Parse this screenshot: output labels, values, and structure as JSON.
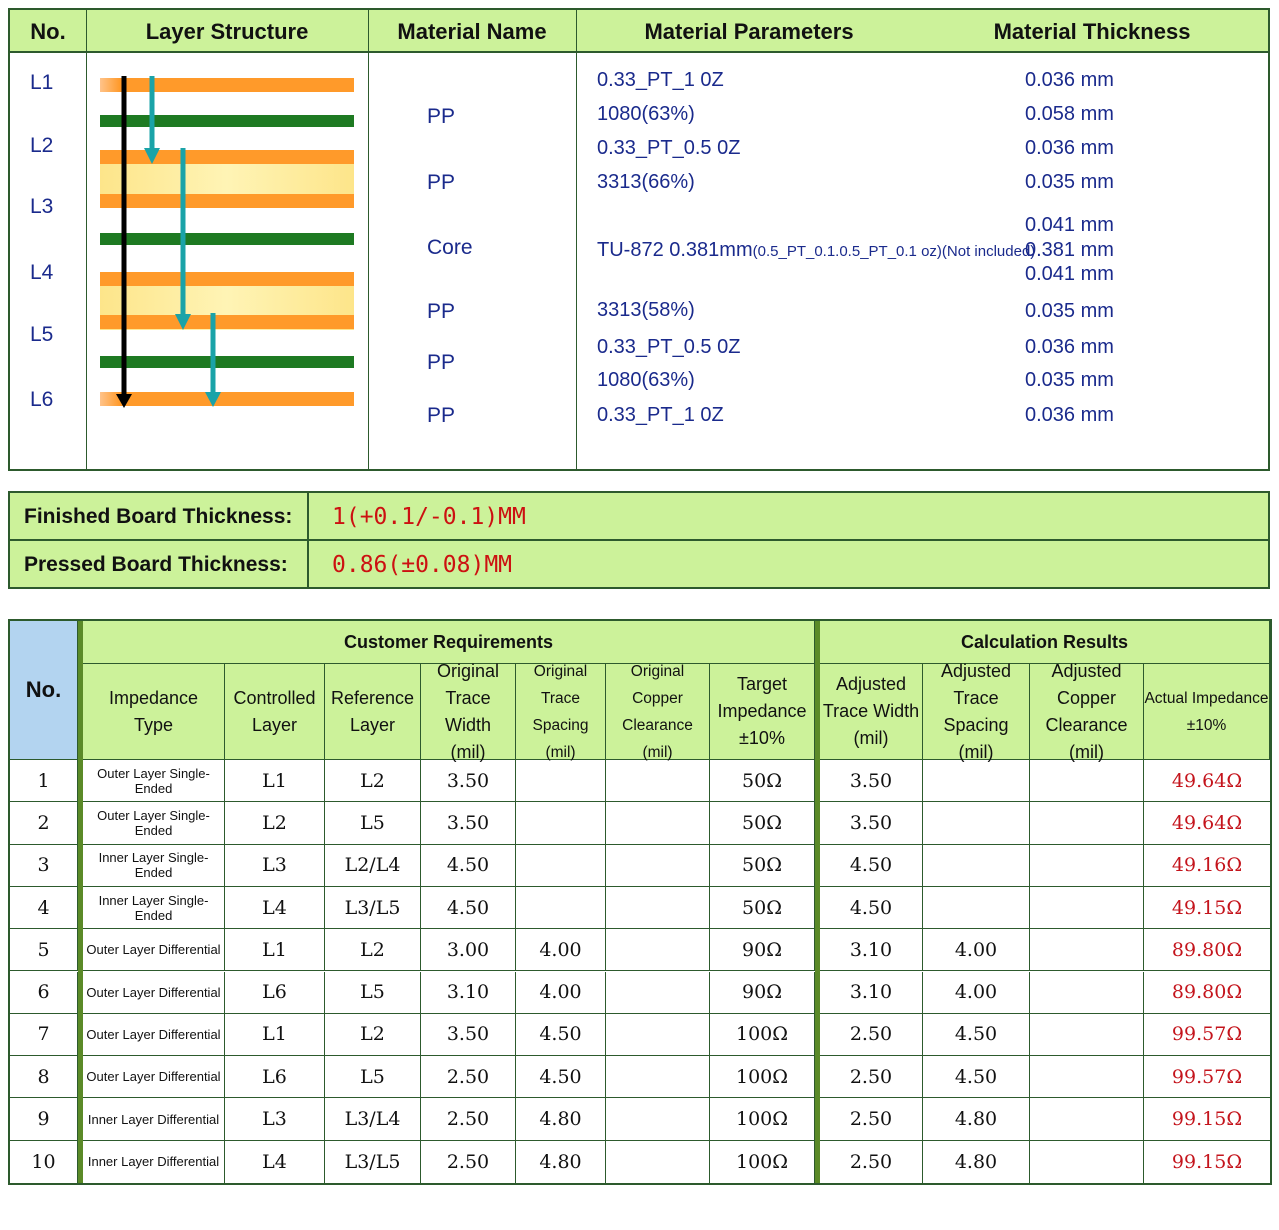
{
  "stackup": {
    "headers": {
      "no": "No.",
      "structure": "Layer Structure",
      "material_name": "Material Name",
      "parameters": "Material Parameters",
      "thickness": "Material Thickness"
    },
    "layer_labels": [
      "L1",
      "L2",
      "L3",
      "L4",
      "L5",
      "L6"
    ],
    "material_names": [
      "PP",
      "PP",
      "Core",
      "PP",
      "PP",
      "PP"
    ],
    "parameters": {
      "p1": "0.33_PT_1 0Z",
      "p2": "1080(63%)",
      "p3": "0.33_PT_0.5 0Z",
      "p4": "3313(66%)",
      "p5_main": "TU-872 0.381mm",
      "p5_small": "(0.5_PT_0.1.0.5_PT_0.1 oz)(Not included)",
      "p6": "3313(58%)",
      "p7": "0.33_PT_0.5 0Z",
      "p8": "1080(63%)",
      "p9": "0.33_PT_1 0Z"
    },
    "thicknesses": [
      "0.036 mm",
      "0.058 mm",
      "0.036 mm",
      "0.035 mm",
      "0.041 mm",
      "0.381 mm",
      "0.041 mm",
      "0.035 mm",
      "0.036 mm",
      "0.035 mm",
      "0.036 mm"
    ],
    "colors": {
      "copper": "#ff9a2a",
      "prepreg": "#1e7a22",
      "core": "#fde58a",
      "arrow_main": "#000000",
      "arrow_ref": "#1aa3a8"
    }
  },
  "board_thickness": {
    "finished_label": "Finished Board Thickness:",
    "finished_value": "1(+0.1/-0.1)MM",
    "pressed_label": "Pressed Board Thickness:",
    "pressed_value": "0.86(±0.08)MM"
  },
  "impedance": {
    "no_header": "No.",
    "group_customer": "Customer Requirements",
    "group_results": "Calculation Results",
    "columns": {
      "type": [
        "Impedance",
        "Type"
      ],
      "controlled": [
        "Controlled",
        "Layer"
      ],
      "reference": [
        "Reference",
        "Layer"
      ],
      "orig_width": [
        "Original",
        "Trace Width",
        "(mil)"
      ],
      "orig_spacing": [
        "Original",
        "Trace",
        "Spacing (mil)"
      ],
      "orig_clear": [
        "Original",
        "Copper",
        "Clearance (mil)"
      ],
      "target": [
        "Target",
        "Impedance",
        "±10%"
      ],
      "adj_width": [
        "Adjusted",
        "Trace Width",
        "(mil)"
      ],
      "adj_spacing": [
        "Adjusted",
        "Trace Spacing",
        "(mil)"
      ],
      "adj_clear": [
        "Adjusted",
        "Copper",
        "Clearance (mil)"
      ],
      "actual": [
        "Actual Impedance",
        "±10%"
      ]
    },
    "rows": [
      {
        "no": "1",
        "type": "Outer Layer Single-Ended",
        "ctrl": "L1",
        "ref": "L2",
        "ow": "3.50",
        "os": "",
        "oc": "",
        "target": "50Ω",
        "aw": "3.50",
        "as": "",
        "ac": "",
        "actual": "49.64Ω"
      },
      {
        "no": "2",
        "type": "Outer Layer Single-Ended",
        "ctrl": "L2",
        "ref": "L5",
        "ow": "3.50",
        "os": "",
        "oc": "",
        "target": "50Ω",
        "aw": "3.50",
        "as": "",
        "ac": "",
        "actual": "49.64Ω"
      },
      {
        "no": "3",
        "type": "Inner Layer Single-Ended",
        "ctrl": "L3",
        "ref": "L2/L4",
        "ow": "4.50",
        "os": "",
        "oc": "",
        "target": "50Ω",
        "aw": "4.50",
        "as": "",
        "ac": "",
        "actual": "49.16Ω"
      },
      {
        "no": "4",
        "type": "Inner Layer Single-Ended",
        "ctrl": "L4",
        "ref": "L3/L5",
        "ow": "4.50",
        "os": "",
        "oc": "",
        "target": "50Ω",
        "aw": "4.50",
        "as": "",
        "ac": "",
        "actual": "49.15Ω"
      },
      {
        "no": "5",
        "type": "Outer Layer Differential",
        "ctrl": "L1",
        "ref": "L2",
        "ow": "3.00",
        "os": "4.00",
        "oc": "",
        "target": "90Ω",
        "aw": "3.10",
        "as": "4.00",
        "ac": "",
        "actual": "89.80Ω"
      },
      {
        "no": "6",
        "type": "Outer Layer Differential",
        "ctrl": "L6",
        "ref": "L5",
        "ow": "3.10",
        "os": "4.00",
        "oc": "",
        "target": "90Ω",
        "aw": "3.10",
        "as": "4.00",
        "ac": "",
        "actual": "89.80Ω"
      },
      {
        "no": "7",
        "type": "Outer Layer Differential",
        "ctrl": "L1",
        "ref": "L2",
        "ow": "3.50",
        "os": "4.50",
        "oc": "",
        "target": "100Ω",
        "aw": "2.50",
        "as": "4.50",
        "ac": "",
        "actual": "99.57Ω"
      },
      {
        "no": "8",
        "type": "Outer Layer Differential",
        "ctrl": "L6",
        "ref": "L5",
        "ow": "2.50",
        "os": "4.50",
        "oc": "",
        "target": "100Ω",
        "aw": "2.50",
        "as": "4.50",
        "ac": "",
        "actual": "99.57Ω"
      },
      {
        "no": "9",
        "type": "Inner Layer Differential",
        "ctrl": "L3",
        "ref": "L3/L4",
        "ow": "2.50",
        "os": "4.80",
        "oc": "",
        "target": "100Ω",
        "aw": "2.50",
        "as": "4.80",
        "ac": "",
        "actual": "99.15Ω"
      },
      {
        "no": "10",
        "type": "Inner Layer Differential",
        "ctrl": "L4",
        "ref": "L3/L5",
        "ow": "2.50",
        "os": "4.80",
        "oc": "",
        "target": "100Ω",
        "aw": "2.50",
        "as": "4.80",
        "ac": "",
        "actual": "99.15Ω"
      }
    ]
  }
}
